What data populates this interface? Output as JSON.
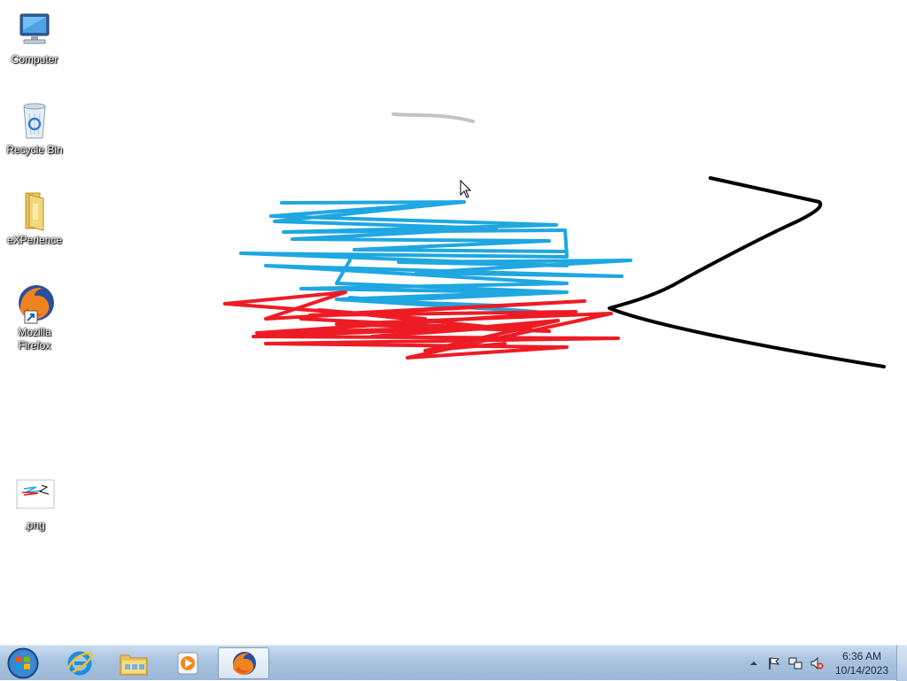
{
  "desktop": {
    "icons": [
      {
        "label": "Computer",
        "icon": "computer-icon"
      },
      {
        "label": "Recycle Bin",
        "icon": "recycle-bin-icon"
      },
      {
        "label": "eXPerience",
        "icon": "folder-icon"
      },
      {
        "label": "Mozilla Firefox",
        "icon": "firefox-icon"
      },
      {
        "label": ".png",
        "icon": "image-file-icon"
      }
    ]
  },
  "drawing": {
    "colors": {
      "blue": "#1ea7e1",
      "red": "#ed1c24",
      "black": "#000000",
      "gray": "#c3c3c3"
    }
  },
  "taskbar": {
    "pinned": [
      "internet-explorer-icon",
      "windows-explorer-icon",
      "media-player-icon",
      "firefox-icon"
    ],
    "clock": {
      "time": "6:36 AM",
      "date": "10/14/2023"
    },
    "tray": [
      "show-hidden-icons-arrow",
      "action-center-flag-icon",
      "network-icon",
      "volume-muted-icon"
    ]
  }
}
